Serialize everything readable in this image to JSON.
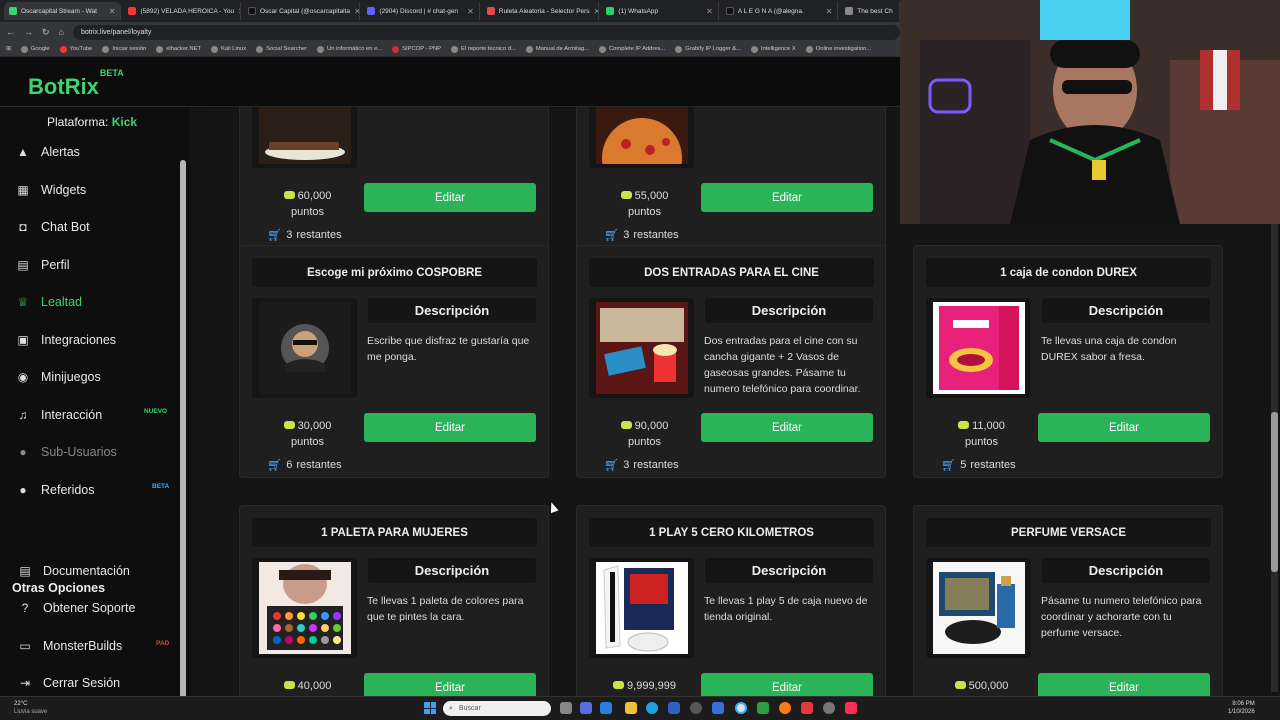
{
  "browser": {
    "tabs": [
      {
        "label": "Oscarcapital Stream - Wat",
        "color": "#3dd36e"
      },
      {
        "label": "(5892) VELADA HEROICA - You",
        "color": "#ff3333"
      },
      {
        "label": "Oscar Capital (@oscarcapitalta",
        "color": "#222222"
      },
      {
        "label": "(2904) Discord | # chat-gen",
        "color": "#5865f2"
      },
      {
        "label": "Ruleta Aleatoria - Selector Pers",
        "color": "#e24a4a"
      },
      {
        "label": "(1) WhatsApp",
        "color": "#25d366"
      },
      {
        "label": "A L E G N A (@alegna.",
        "color": "#222222"
      },
      {
        "label": "The best Ch",
        "color": "#888888"
      }
    ],
    "url": "botrix.live/panel/loyalty",
    "bookmarks": [
      "Google",
      "YouTube",
      "Iniciar sesión",
      "elhacker.NET",
      "Kali Linux",
      "Social Searcher",
      "Un informático en e...",
      "SIPCOP - PNP",
      "El reporte técnico d...",
      "Manual de Armitag...",
      "Complete IP Addres...",
      "Grabify IP Logger &...",
      "Intelligence X",
      "Online investigation..."
    ]
  },
  "app": {
    "logo": "BotRix",
    "logo_badge": "BETA",
    "platform_label": "Plataforma:",
    "platform_value": "Kick"
  },
  "sidebar": {
    "items": [
      {
        "label": "Alertas",
        "icon": "warning-icon"
      },
      {
        "label": "Widgets",
        "icon": "grid-icon"
      },
      {
        "label": "Chat Bot",
        "icon": "robot-icon"
      },
      {
        "label": "Perfil",
        "icon": "profile-icon"
      },
      {
        "label": "Lealtad",
        "icon": "trophy-icon"
      },
      {
        "label": "Integraciones",
        "icon": "plug-icon"
      },
      {
        "label": "Minijuegos",
        "icon": "gamepad-icon"
      },
      {
        "label": "Interacción",
        "icon": "music-icon",
        "badge": "NUEVO"
      },
      {
        "label": "Sub-Usuarios",
        "icon": "users-icon"
      },
      {
        "label": "Referidos",
        "icon": "referral-icon",
        "badge": "BETA"
      }
    ],
    "other_title": "Otras Opciones",
    "other_items": [
      {
        "label": "Documentación",
        "icon": "document-icon"
      },
      {
        "label": "Obtener Soporte",
        "icon": "help-icon"
      },
      {
        "label": "MonsterBuilds",
        "icon": "monitor-icon",
        "badge": "PAD"
      },
      {
        "label": "Cerrar Sesión",
        "icon": "logout-icon"
      }
    ]
  },
  "rewards": {
    "desc_header": "Descripción",
    "edit_label": "Editar",
    "points_unit": "puntos",
    "remaining_unit": "restantes",
    "items": [
      {
        "title": "",
        "points": "60,000",
        "remaining": "3",
        "description": ""
      },
      {
        "title": "",
        "points": "55,000",
        "remaining": "3",
        "description": ""
      },
      {
        "title": "Escoge mi próximo COSPOBRE",
        "points": "30,000",
        "remaining": "6",
        "description": "Escribe que disfraz te gustaría que me ponga."
      },
      {
        "title": "DOS ENTRADAS PARA EL CINE",
        "points": "90,000",
        "remaining": "3",
        "description": "Dos entradas para el cine con su cancha gigante + 2 Vasos de gaseosas grandes. Pásame tu numero telefónico para coordinar."
      },
      {
        "title": "1 caja de condon DUREX",
        "points": "11,000",
        "remaining": "5",
        "description": "Te llevas una caja de condon DUREX sabor a fresa."
      },
      {
        "title": "1 PALETA PARA MUJERES",
        "points": "40,000",
        "remaining": "",
        "description": "Te llevas 1 paleta de colores para que te pintes la cara."
      },
      {
        "title": "1 PLAY 5 CERO KILOMETROS",
        "points": "9,999,999",
        "remaining": "",
        "description": "Te llevas 1 play 5 de caja nuevo de tienda original."
      },
      {
        "title": "PERFUME VERSACE",
        "points": "500,000",
        "remaining": "",
        "description": "Pásame tu numero telefónico para coordinar y achorarte con tu perfume versace."
      }
    ]
  },
  "taskbar": {
    "weather_temp": "22°C",
    "weather_text": "Lluvia suave",
    "search_placeholder": "Buscar",
    "time": "8:06 PM",
    "date": "1/10/2026"
  }
}
